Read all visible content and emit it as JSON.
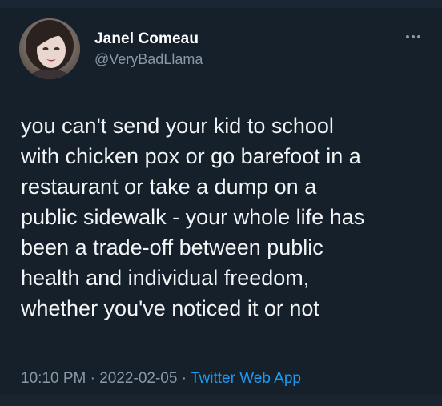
{
  "tweet": {
    "author": {
      "name": "Janel Comeau",
      "handle": "@VeryBadLlama",
      "avatar": "profile-photo"
    },
    "more_icon": "more-options-icon",
    "text_lines": [
      "you can't send your kid to school",
      "with chicken pox or go barefoot in a",
      "restaurant or take a dump on a",
      "public sidewalk - your whole life has",
      "been a trade-off between public",
      "health and individual freedom,",
      "whether you've noticed it or not"
    ],
    "time": "10:10 PM",
    "separator": "·",
    "date": "2022-02-05",
    "source": "Twitter Web App"
  },
  "colors": {
    "background": "#15202b",
    "text": "#f2f4f5",
    "secondary": "#8b98a5",
    "link": "#1d9bf0"
  }
}
